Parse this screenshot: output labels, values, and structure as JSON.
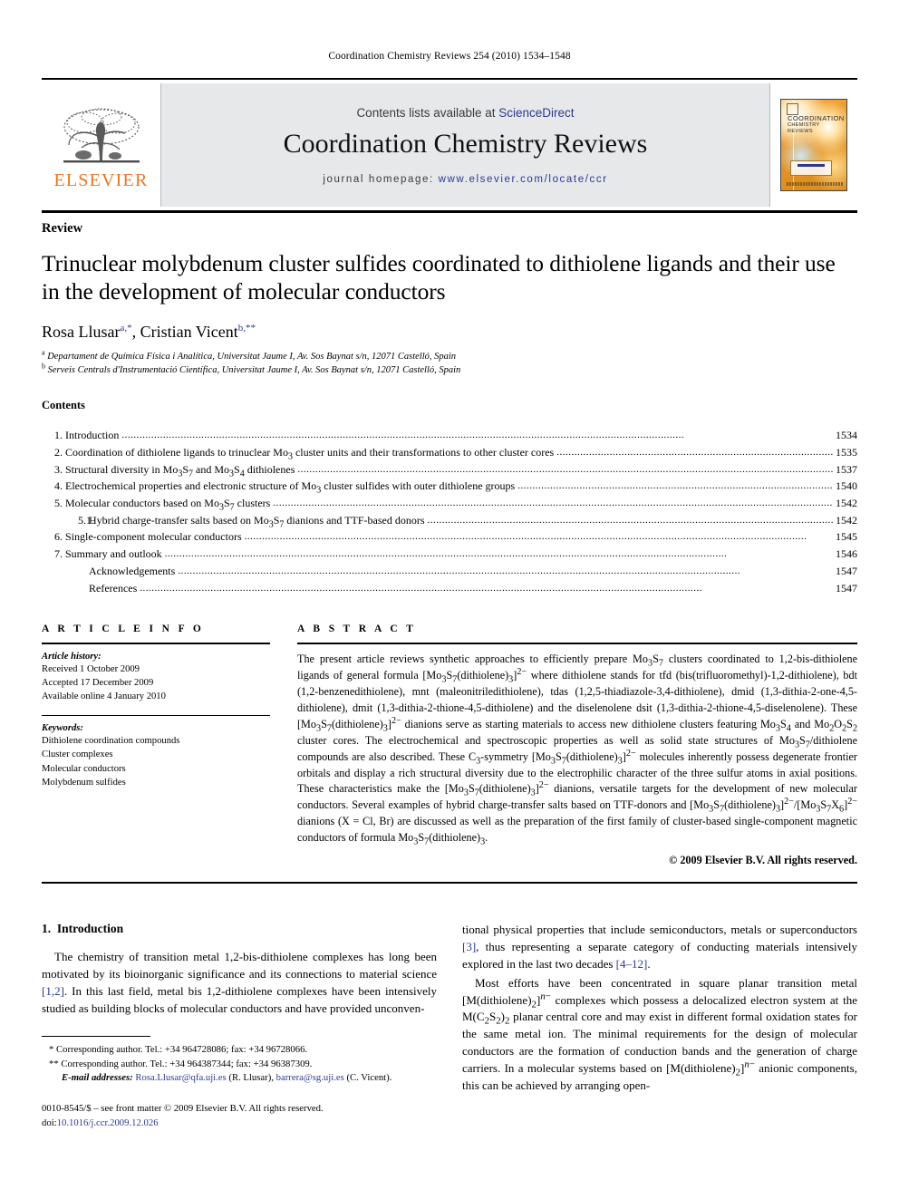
{
  "running_head": "Coordination Chemistry Reviews 254 (2010) 1534–1548",
  "masthead": {
    "publisher_name": "ELSEVIER",
    "contents_prefix": "Contents lists available at ",
    "contents_link": "ScienceDirect",
    "journal_name": "Coordination Chemistry Reviews",
    "homepage_prefix": "journal homepage: ",
    "homepage_url": "www.elsevier.com/locate/ccr",
    "cover_title_line1": "COORDINATION",
    "cover_title_line2": "CHEMISTRY REVIEWS",
    "link_color": "#2b3a8f",
    "accent_color": "#E87722",
    "band_color": "#e7e8ea"
  },
  "article": {
    "type": "Review",
    "title": "Trinuclear molybdenum cluster sulfides coordinated to dithiolene ligands and their use in the development of molecular conductors",
    "authors": "Rosa Llusar, Cristian Vicent",
    "author1_name": "Rosa Llusar",
    "author1_marks": "a,*",
    "author2_name": "Cristian Vicent",
    "author2_marks": "b,**",
    "affiliation_a": "Departament de Química Física i Analítica, Universitat Jaume I, Av. Sos Baynat s/n, 12071 Castelló, Spain",
    "affiliation_b": "Serveis Centrals d'Instrumentació Científica, Universitat Jaume I, Av. Sos Baynat s/n, 12071 Castelló, Spain"
  },
  "contents": {
    "heading": "Contents",
    "entries": [
      {
        "num": "1.",
        "label": "Introduction",
        "page": "1534",
        "level": 1
      },
      {
        "num": "2.",
        "label": "Coordination of dithiolene ligands to trinuclear Mo3 cluster units and their transformations to other cluster cores",
        "page": "1535",
        "level": 1
      },
      {
        "num": "3.",
        "label": "Structural diversity in Mo3S7 and Mo3S4 dithiolenes",
        "page": "1537",
        "level": 1
      },
      {
        "num": "4.",
        "label": "Electrochemical properties and electronic structure of Mo3 cluster sulfides with outer dithiolene groups",
        "page": "1540",
        "level": 1
      },
      {
        "num": "5.",
        "label": "Molecular conductors based on Mo3S7 clusters",
        "page": "1542",
        "level": 1
      },
      {
        "num": "5.1.",
        "label": "Hybrid charge-transfer salts based on Mo3S7 dianions and TTF-based donors",
        "page": "1542",
        "level": 2
      },
      {
        "num": "6.",
        "label": "Single-component molecular conductors",
        "page": "1545",
        "level": 1
      },
      {
        "num": "7.",
        "label": "Summary and outlook",
        "page": "1546",
        "level": 1
      },
      {
        "num": "",
        "label": "Acknowledgements",
        "page": "1547",
        "level": 3
      },
      {
        "num": "",
        "label": "References",
        "page": "1547",
        "level": 3
      }
    ]
  },
  "article_info": {
    "heading": "A R T I C L E   I N F O",
    "history_label": "Article history:",
    "received": "Received 1 October 2009",
    "accepted": "Accepted 17 December 2009",
    "available": "Available online 4 January 2010",
    "keywords_label": "Keywords:",
    "keywords": [
      "Dithiolene coordination compounds",
      "Cluster complexes",
      "Molecular conductors",
      "Molybdenum sulfides"
    ]
  },
  "abstract": {
    "heading": "A B S T R A C T",
    "text": "The present article reviews synthetic approaches to efficiently prepare Mo3S7 clusters coordinated to 1,2-bis-dithiolene ligands of general formula [Mo3S7(dithiolene)3]2− where dithiolene stands for tfd (bis(trifluoromethyl)-1,2-dithiolene), bdt (1,2-benzenedithiolene), mnt (maleonitriledithiolene), tdas (1,2,5-thiadiazole-3,4-dithiolene), dmid (1,3-dithia-2-one-4,5-dithiolene), dmit (1,3-dithia-2-thione-4,5-dithiolene) and the diselenolene dsit (1,3-dithia-2-thione-4,5-diselenolene). These [Mo3S7(dithiolene)3]2− dianions serve as starting materials to access new dithiolene clusters featuring Mo3S4 and Mo2O2S2 cluster cores. The electrochemical and spectroscopic properties as well as solid state structures of Mo3S7/dithiolene compounds are also described. These C3-symmetry [Mo3S7(dithiolene)3]2− molecules inherently possess degenerate frontier orbitals and display a rich structural diversity due to the electrophilic character of the three sulfur atoms in axial positions. These characteristics make the [Mo3S7(dithiolene)3]2− dianions, versatile targets for the development of new molecular conductors. Several examples of hybrid charge-transfer salts based on TTF-donors and [Mo3S7(dithiolene)3]2−/[Mo3S7X6]2− dianions (X = Cl, Br) are discussed as well as the preparation of the first family of cluster-based single-component magnetic conductors of formula Mo3S7(dithiolene)3.",
    "copyright": "© 2009 Elsevier B.V. All rights reserved."
  },
  "introduction": {
    "section_number": "1.",
    "section_title": "Introduction",
    "left_paragraph": "The chemistry of transition metal 1,2-bis-dithiolene complexes has long been motivated by its bioinorganic significance and its connections to material science [1,2]. In this last field, metal bis 1,2-dithiolene complexes have been intensively studied as building blocks of molecular conductors and have provided unconven-",
    "right_paragraph_1": "tional physical properties that include semiconductors, metals or superconductors [3], thus representing a separate category of conducting materials intensively explored in the last two decades [4–12].",
    "right_paragraph_2": "Most efforts have been concentrated in square planar transition metal [M(dithiolene)2]n− complexes which possess a delocalized electron system at the M(C2S2)2 planar central core and may exist in different formal oxidation states for the same metal ion. The minimal requirements for the design of molecular conductors are the formation of conduction bands and the generation of charge carriers. In a molecular systems based on [M(dithiolene)2]n− anionic components, this can be achieved by arranging open-"
  },
  "footnotes": {
    "line1": "* Corresponding author. Tel.: +34 964728086; fax: +34 96728066.",
    "line2": "** Corresponding author. Tel.: +34 964387344; fax: +34 96387309.",
    "email_label": "E-mail addresses:",
    "email1": "Rosa.Llusar@qfa.uji.es",
    "email1_owner": "(R. Llusar),",
    "email2": "barrera@sg.uji.es",
    "email2_owner": "(C. Vicent)."
  },
  "imprint": {
    "line1": "0010-8545/$ – see front matter © 2009 Elsevier B.V. All rights reserved.",
    "doi_prefix": "doi:",
    "doi": "10.1016/j.ccr.2009.12.026"
  }
}
